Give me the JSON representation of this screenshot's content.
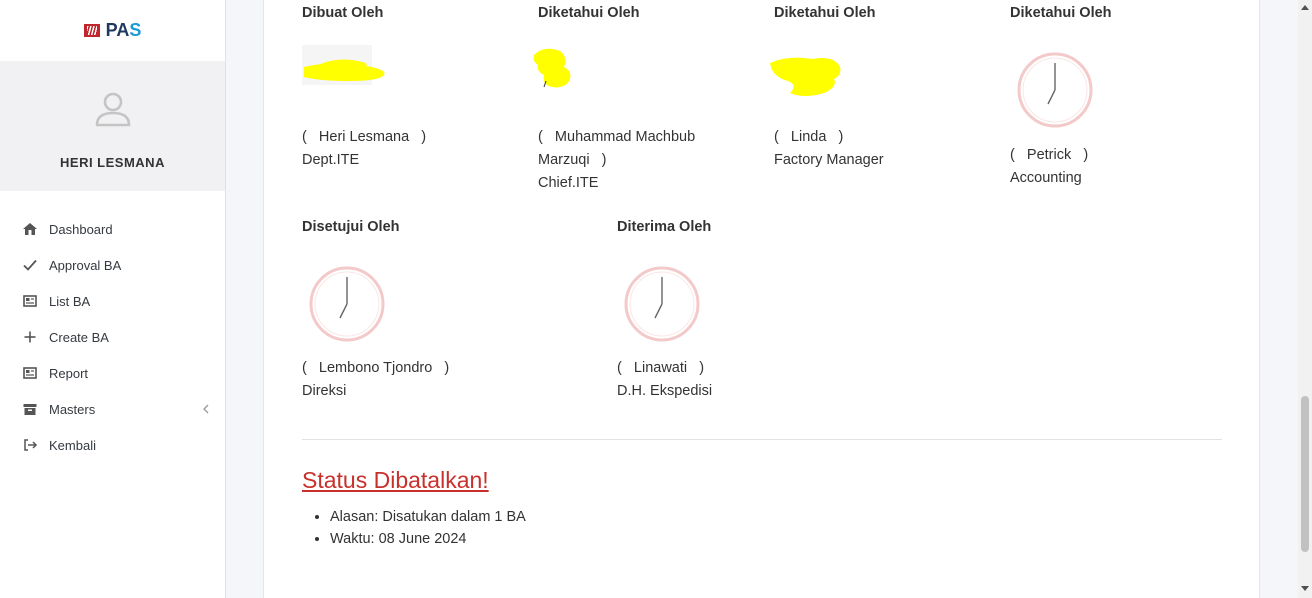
{
  "app": {
    "brand_part1": "PA",
    "brand_part2": "S",
    "brand_color": "#c0262b"
  },
  "user": {
    "name": "HERI LESMANA"
  },
  "sidebar": {
    "items": [
      {
        "label": "Dashboard",
        "icon": "home-icon"
      },
      {
        "label": "Approval BA",
        "icon": "check-icon"
      },
      {
        "label": "List BA",
        "icon": "newspaper-icon"
      },
      {
        "label": "Create BA",
        "icon": "plus-icon"
      },
      {
        "label": "Report",
        "icon": "newspaper-icon"
      },
      {
        "label": "Masters",
        "icon": "archive-icon",
        "has_submenu": true
      },
      {
        "label": "Kembali",
        "icon": "sign-out-icon"
      }
    ]
  },
  "signatures": [
    {
      "heading": "Dibuat Oleh",
      "name": "Heri Lesmana",
      "role": "Dept.ITE",
      "signed": true
    },
    {
      "heading": "Diketahui Oleh",
      "name": "Muhammad Machbub Marzuqi",
      "role": "Chief.ITE",
      "signed": true
    },
    {
      "heading": "Diketahui Oleh",
      "name": "Linda",
      "role": "Factory Manager",
      "signed": true
    },
    {
      "heading": "Diketahui Oleh",
      "name": "Petrick",
      "role": "Accounting",
      "signed": false
    },
    {
      "heading": "Disetujui Oleh",
      "name": "Lembono Tjondro",
      "role": "Direksi",
      "signed": false
    },
    {
      "heading": "Diterima Oleh",
      "name": "Linawati",
      "role": "D.H. Ekspedisi",
      "signed": false
    }
  ],
  "status": {
    "title": "Status Dibatalkan!",
    "color": "#c9302c",
    "details": [
      "Alasan: Disatukan dalam 1 BA",
      "Waktu: 08 June 2024"
    ]
  },
  "colors": {
    "redaction": "#ffff00",
    "pending_clock": "#f3c9c9"
  }
}
